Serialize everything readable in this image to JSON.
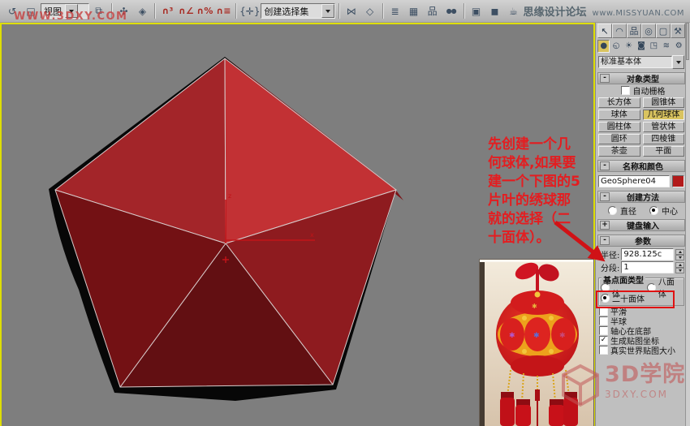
{
  "toolbar": {
    "watermark": "WWW.3DXY.COM",
    "view_dropdown": "视图",
    "selection_set_dropdown": "创建选择集",
    "site_name": "思缘设计论坛",
    "site_url": "www.MISSYUAN.COM",
    "icons_a": [
      {
        "name": "undo-icon",
        "glyph": "↺"
      },
      {
        "name": "scene-view-icon",
        "glyph": "◱"
      }
    ],
    "icons_b": [
      {
        "name": "displays-icon",
        "glyph": "⧉"
      },
      {
        "name": "select-and-link-icon",
        "glyph": "✣"
      },
      {
        "name": "bind-spacewarp-icon",
        "glyph": "◈"
      },
      {
        "name": "snap-toggle-icon",
        "glyph": "∩³"
      },
      {
        "name": "angle-snap-icon",
        "glyph": "∩∠"
      },
      {
        "name": "percent-snap-icon",
        "glyph": "∩%"
      },
      {
        "name": "spinner-snap-icon",
        "glyph": "∩≡"
      },
      {
        "name": "named-selection-icon",
        "glyph": "{✛}"
      }
    ],
    "icons_c": [
      {
        "name": "mirror-icon",
        "glyph": "⋈"
      },
      {
        "name": "align-icon",
        "glyph": "◇"
      },
      {
        "name": "layer-manager-icon",
        "glyph": "≣"
      },
      {
        "name": "curve-editor-icon",
        "glyph": "▦"
      },
      {
        "name": "schematic-view-icon",
        "glyph": "品"
      },
      {
        "name": "material-editor-icon",
        "glyph": "●●"
      },
      {
        "name": "render-setup-icon",
        "glyph": "▣"
      },
      {
        "name": "render-frame-icon",
        "glyph": "◼"
      },
      {
        "name": "quick-render-icon",
        "glyph": "☕"
      }
    ]
  },
  "viewport": {
    "annotation_lines": [
      "先创建一个几",
      "何球体,如果要",
      "建一个下图的5",
      "片叶的绣球那",
      "就的选择（二",
      "十面体）。"
    ],
    "scene_object": "GeoSphere icosahedron, 1 segment, red shaded with wireframe edges",
    "colors": {
      "viewport_bg": "#7e7e7e",
      "active_border": "#dede00",
      "face_top_right": "#c23134",
      "face_top_left": "#a32529",
      "face_right": "#8e1b1f",
      "face_bottom": "#620f12",
      "face_left": "#731114",
      "edge": "#d8cccc",
      "annotation_red": "#e41d20"
    }
  },
  "panel": {
    "tabs": [
      {
        "name": "tab-create",
        "glyph": "↖"
      },
      {
        "name": "tab-modify",
        "glyph": "◠"
      },
      {
        "name": "tab-hierarchy",
        "glyph": "品"
      },
      {
        "name": "tab-motion",
        "glyph": "◎"
      },
      {
        "name": "tab-display",
        "glyph": "▢"
      },
      {
        "name": "tab-utilities",
        "glyph": "⚒"
      }
    ],
    "categories": [
      {
        "name": "category-geometry",
        "glyph": "●"
      },
      {
        "name": "category-shapes",
        "glyph": "◵"
      },
      {
        "name": "category-lights",
        "glyph": "☀"
      },
      {
        "name": "category-cameras",
        "glyph": "◙"
      },
      {
        "name": "category-helpers",
        "glyph": "◳"
      },
      {
        "name": "category-spacewarps",
        "glyph": "≋"
      },
      {
        "name": "category-systems",
        "glyph": "⚙"
      }
    ],
    "primitive_dropdown": "标准基本体",
    "object_type": {
      "state": "-",
      "title": "对象类型",
      "autogrid": "自动栅格",
      "buttons": [
        "长方体",
        "圆锥体",
        "球体",
        "几何球体",
        "圆柱体",
        "管状体",
        "圆环",
        "四棱锥",
        "茶壶",
        "平面"
      ],
      "active_button": "几何球体"
    },
    "name_color": {
      "state": "-",
      "title": "名称和颜色",
      "name_value": "GeoSphere04",
      "swatch_color": "#b21a1a"
    },
    "creation_method": {
      "state": "-",
      "title": "创建方法",
      "diameter": "直径",
      "center": "中心",
      "selected": "中心"
    },
    "keyboard_entry": {
      "state": "+",
      "title": "键盘输入"
    },
    "parameters": {
      "state": "-",
      "title": "参数",
      "radius_label": "半径:",
      "radius_value": "928.125c",
      "segments_label": "分段:",
      "segments_value": "1",
      "base_type": {
        "title": "基点面类型",
        "tetra": "四面体",
        "octa": "八面体",
        "icosa": "二十面体",
        "selected": "二十面体"
      },
      "checks": [
        {
          "label": "平滑",
          "mark": ""
        },
        {
          "label": "半球",
          "mark": ""
        },
        {
          "label": "轴心在底部",
          "mark": ""
        },
        {
          "label": "生成贴图坐标",
          "mark": "✓"
        },
        {
          "label": "真实世界贴图大小",
          "mark": ""
        }
      ]
    }
  },
  "watermark_bottom": {
    "title": "3D学院",
    "url": "3DXY.COM"
  }
}
